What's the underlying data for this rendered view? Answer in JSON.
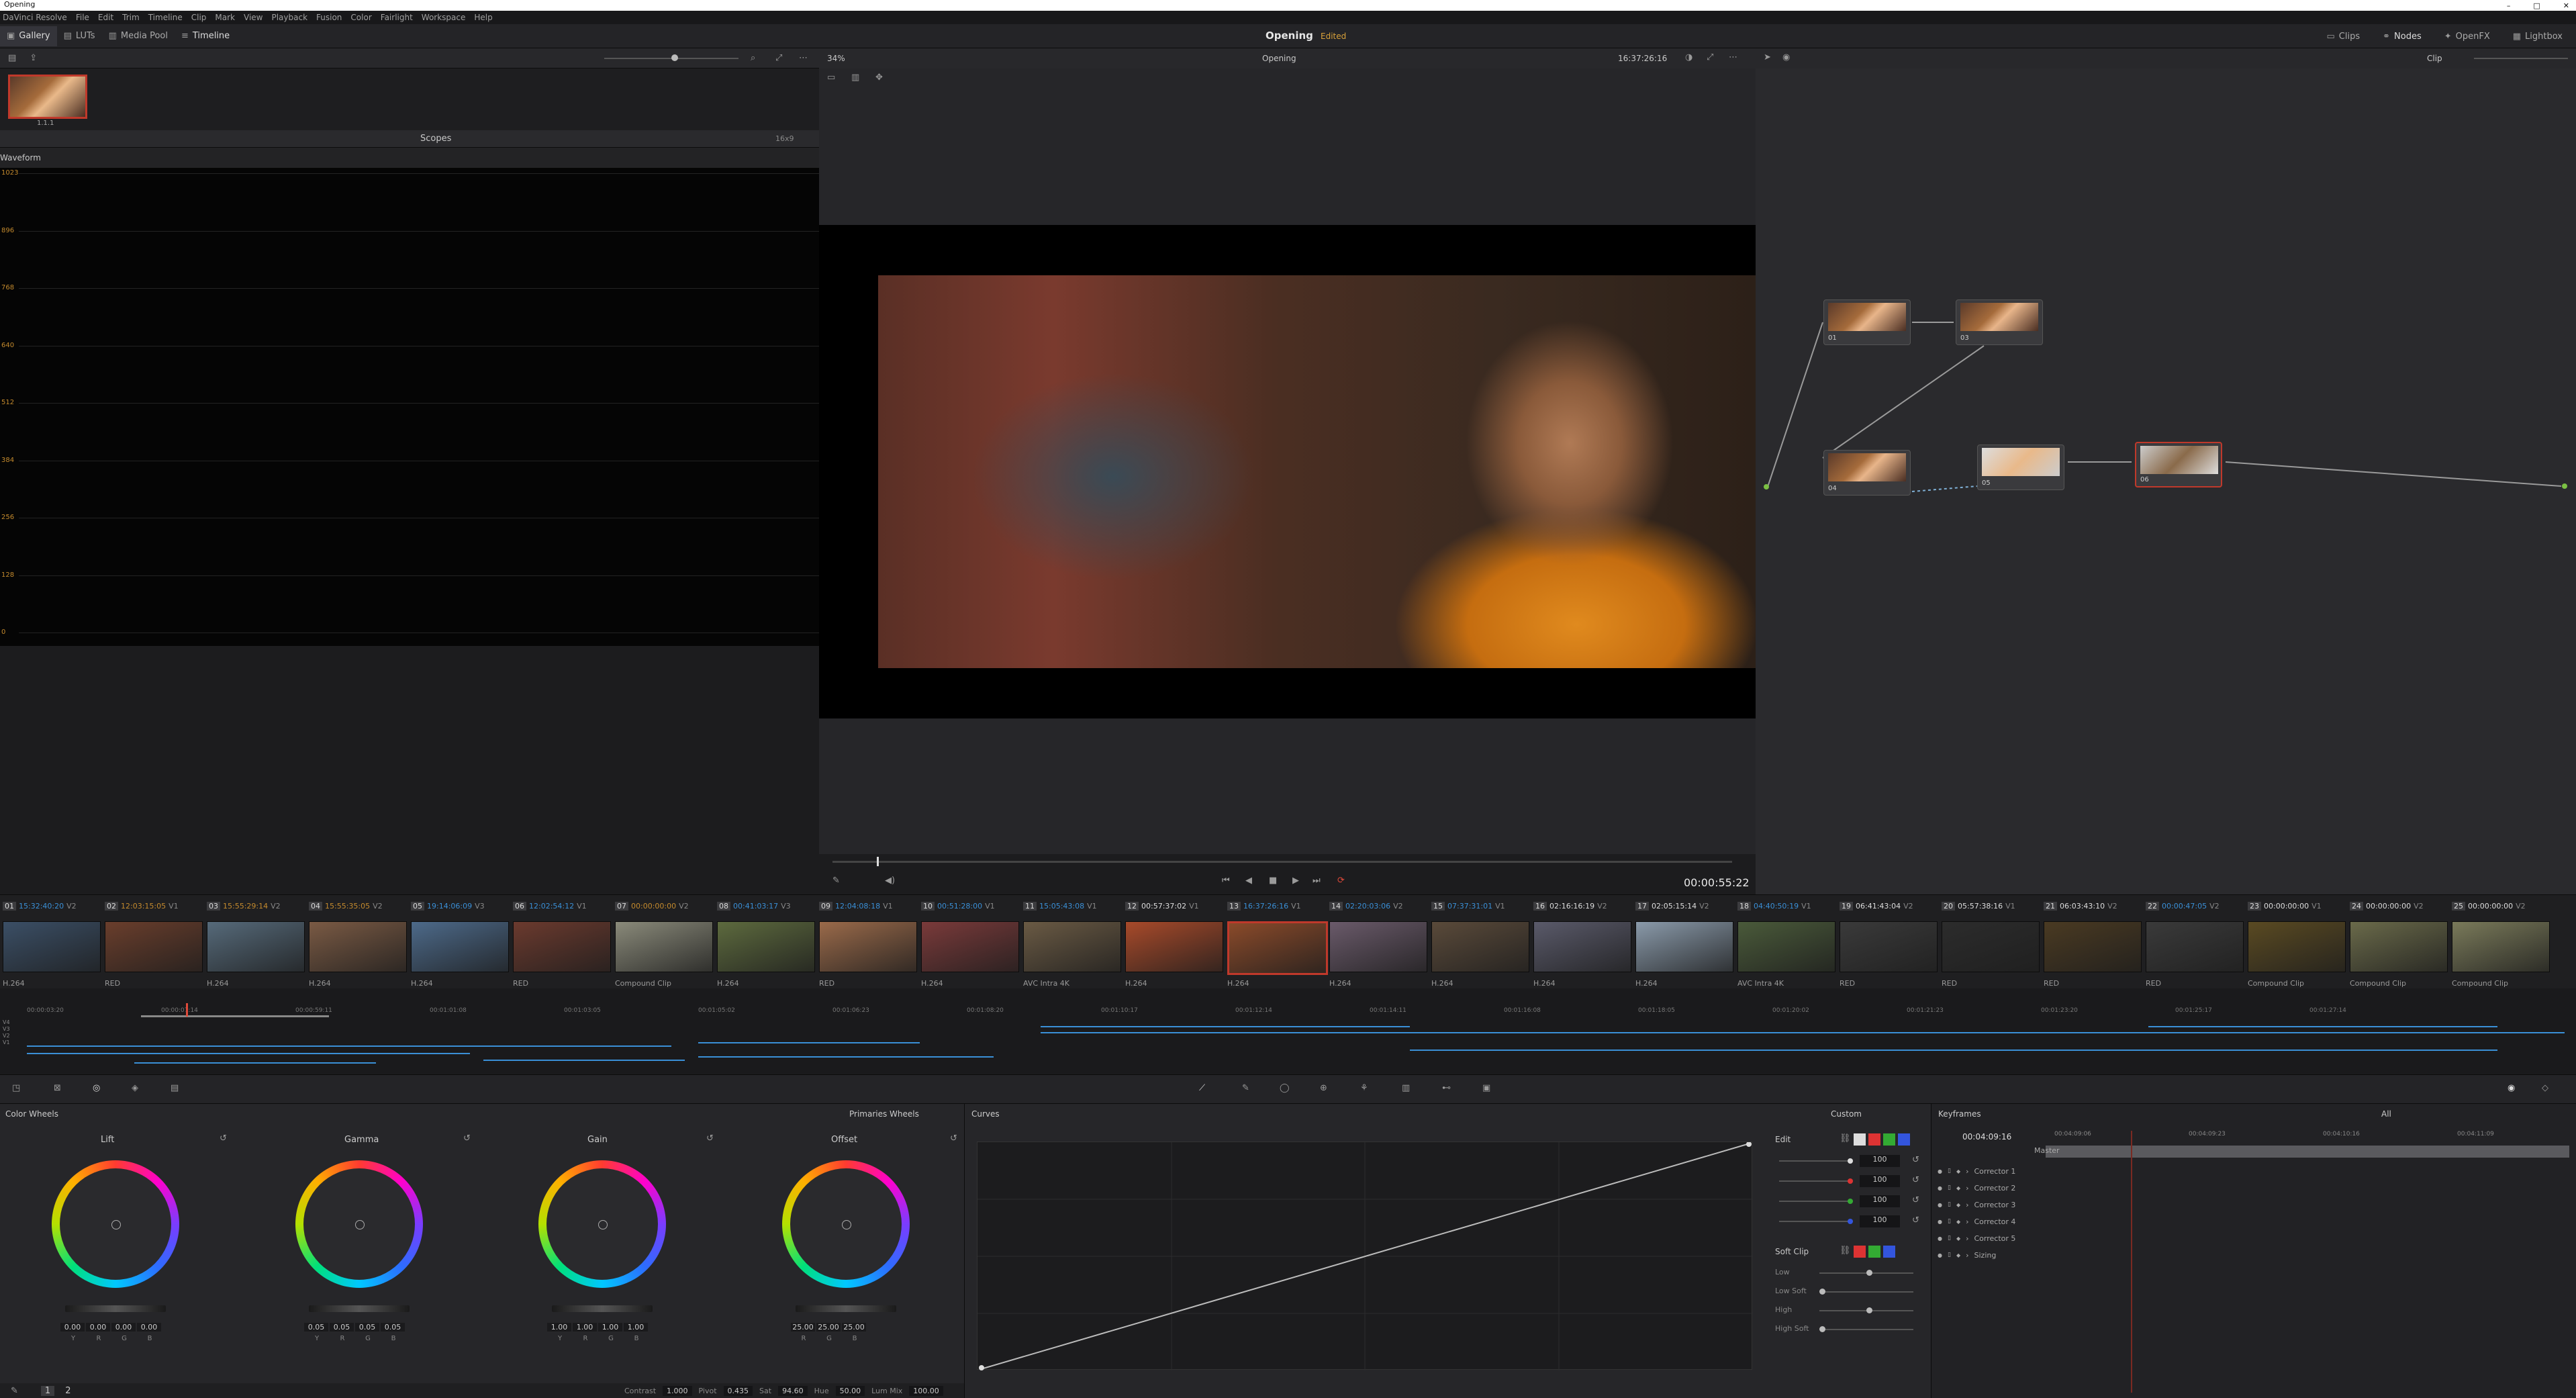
{
  "window": {
    "title": "Opening"
  },
  "menu": [
    "DaVinci Resolve",
    "File",
    "Edit",
    "Trim",
    "Timeline",
    "Clip",
    "Mark",
    "View",
    "Playback",
    "Fusion",
    "Color",
    "Fairlight",
    "Workspace",
    "Help"
  ],
  "toolbar": {
    "left": [
      "Gallery",
      "LUTs",
      "Media Pool",
      "Timeline"
    ],
    "project": "Opening",
    "status": "Edited",
    "right": [
      "Clips",
      "Nodes",
      "OpenFX",
      "Lightbox"
    ]
  },
  "viewer": {
    "zoom": "34%",
    "timeline_name": "Opening",
    "source_tc": "16:37:26:16",
    "timecode": "00:00:55:22",
    "playhead_fraction": 0.02
  },
  "gallery": {
    "still_label": "1.1.1"
  },
  "scopes": {
    "title": "Scopes",
    "mode": "Waveform",
    "res": "16x9",
    "scale": [
      "1023",
      "896",
      "768",
      "640",
      "512",
      "384",
      "256",
      "128",
      "0"
    ]
  },
  "nodes": {
    "mode": "Clip",
    "items": [
      {
        "label": "01"
      },
      {
        "label": "03"
      },
      {
        "label": "04"
      },
      {
        "label": "05"
      },
      {
        "label": "06"
      }
    ]
  },
  "clips": [
    {
      "num": "01",
      "tc": "15:32:40:20",
      "trk": "V2",
      "codec": "H.264",
      "color": "#3b4f66"
    },
    {
      "num": "02",
      "tc": "12:03:15:05",
      "trk": "V1",
      "codec": "RED",
      "color": "#6a3e2c"
    },
    {
      "num": "03",
      "tc": "15:55:29:14",
      "trk": "V2",
      "codec": "H.264",
      "color": "#566a7a"
    },
    {
      "num": "04",
      "tc": "15:55:35:05",
      "trk": "V2",
      "codec": "H.264",
      "color": "#7a5a44"
    },
    {
      "num": "05",
      "tc": "19:14:06:09",
      "trk": "V3",
      "codec": "H.264",
      "color": "#4d6a8a"
    },
    {
      "num": "06",
      "tc": "12:02:54:12",
      "trk": "V1",
      "codec": "RED",
      "color": "#6b3a2e"
    },
    {
      "num": "07",
      "tc": "00:00:00:00",
      "trk": "V2",
      "codec": "Compound Clip",
      "color": "#8a8a7a"
    },
    {
      "num": "08",
      "tc": "00:41:03:17",
      "trk": "V3",
      "codec": "H.264",
      "color": "#5d6a3e"
    },
    {
      "num": "09",
      "tc": "12:04:08:18",
      "trk": "V1",
      "codec": "RED",
      "color": "#9a6a4a"
    },
    {
      "num": "10",
      "tc": "00:51:28:00",
      "trk": "V1",
      "codec": "H.264",
      "color": "#7a3a3a"
    },
    {
      "num": "11",
      "tc": "15:05:43:08",
      "trk": "V1",
      "codec": "AVC Intra 4K",
      "color": "#6a5a44"
    },
    {
      "num": "12",
      "tc": "00:57:37:02",
      "trk": "V1",
      "codec": "H.264",
      "color": "#a84a2a"
    },
    {
      "num": "13",
      "tc": "16:37:26:16",
      "trk": "V1",
      "codec": "H.264",
      "color": "#8a4a2a"
    },
    {
      "num": "14",
      "tc": "02:20:03:06",
      "trk": "V2",
      "codec": "H.264",
      "color": "#6a5a6a"
    },
    {
      "num": "15",
      "tc": "07:37:31:01",
      "trk": "V1",
      "codec": "H.264",
      "color": "#5a4a3a"
    },
    {
      "num": "16",
      "tc": "02:16:16:19",
      "trk": "V2",
      "codec": "H.264",
      "color": "#5a5a6a"
    },
    {
      "num": "17",
      "tc": "02:05:15:14",
      "trk": "V2",
      "codec": "H.264",
      "color": "#8a9aaa"
    },
    {
      "num": "18",
      "tc": "04:40:50:19",
      "trk": "V1",
      "codec": "AVC Intra 4K",
      "color": "#4a5a3a"
    },
    {
      "num": "19",
      "tc": "06:41:43:04",
      "trk": "V2",
      "codec": "RED",
      "color": "#3a3a3a"
    },
    {
      "num": "20",
      "tc": "05:57:38:16",
      "trk": "V1",
      "codec": "RED",
      "color": "#2c2c2c"
    },
    {
      "num": "21",
      "tc": "06:03:43:10",
      "trk": "V2",
      "codec": "RED",
      "color": "#4a3a22"
    },
    {
      "num": "22",
      "tc": "00:00:47:05",
      "trk": "V2",
      "codec": "RED",
      "color": "#3a3a3a"
    },
    {
      "num": "23",
      "tc": "00:00:00:00",
      "trk": "V1",
      "codec": "Compound Clip",
      "color": "#5a4a22"
    },
    {
      "num": "24",
      "tc": "00:00:00:00",
      "trk": "V2",
      "codec": "Compound Clip",
      "color": "#6a6a4a"
    },
    {
      "num": "25",
      "tc": "00:00:00:00",
      "trk": "V2",
      "codec": "Compound Clip",
      "color": "#7a7a5a"
    }
  ],
  "mini_timeline": {
    "ruler": [
      "00:00:03:20",
      "00:00:07:14",
      "00:00:59:11",
      "00:01:01:08",
      "00:01:03:05",
      "00:01:05:02",
      "00:01:06:23",
      "00:01:08:20",
      "00:01:10:17",
      "00:01:12:14",
      "00:01:14:11",
      "00:01:16:08",
      "00:01:18:05",
      "00:01:20:02",
      "00:01:21:23",
      "00:01:23:20",
      "00:01:25:17",
      "00:01:27:14"
    ],
    "tracks": [
      "V4",
      "V3",
      "V2",
      "V1"
    ]
  },
  "color_wheels": {
    "title": "Color Wheels",
    "mode": "Primaries Wheels",
    "wheels": [
      {
        "name": "Lift",
        "values": [
          "0.00",
          "0.00",
          "0.00",
          "0.00"
        ]
      },
      {
        "name": "Gamma",
        "values": [
          "0.05",
          "0.05",
          "0.05",
          "0.05"
        ]
      },
      {
        "name": "Gain",
        "values": [
          "1.00",
          "1.00",
          "1.00",
          "1.00"
        ]
      },
      {
        "name": "Offset",
        "values": [
          "25.00",
          "25.00",
          "25.00"
        ]
      }
    ],
    "channels": [
      "Y",
      "R",
      "G",
      "B"
    ],
    "page_nums": [
      "1",
      "2"
    ],
    "adjust": [
      {
        "label": "Contrast",
        "value": "1.000"
      },
      {
        "label": "Pivot",
        "value": "0.435"
      },
      {
        "label": "Sat",
        "value": "94.60"
      },
      {
        "label": "Hue",
        "value": "50.00"
      },
      {
        "label": "Lum Mix",
        "value": "100.00"
      }
    ]
  },
  "curves": {
    "title": "Curves",
    "mode": "Custom",
    "edit_label": "Edit",
    "edit_values": [
      "100",
      "100",
      "100",
      "100"
    ],
    "soft_clip_label": "Soft Clip",
    "soft_clip_rows": [
      "Low",
      "Low Soft",
      "High",
      "High Soft"
    ]
  },
  "keyframes": {
    "title": "Keyframes",
    "filter": "All",
    "timecode": "00:04:09:16",
    "ruler": [
      "00:04:09:06",
      "00:04:09:23",
      "00:04:10:16",
      "00:04:11:09"
    ],
    "rows": [
      "Master",
      "Corrector 1",
      "Corrector 2",
      "Corrector 3",
      "Corrector 4",
      "Corrector 5",
      "Sizing"
    ]
  },
  "colors": {
    "accent": "#c0392b",
    "timecode_orange": "#c48a2d",
    "blue": "#3a8fd6"
  }
}
